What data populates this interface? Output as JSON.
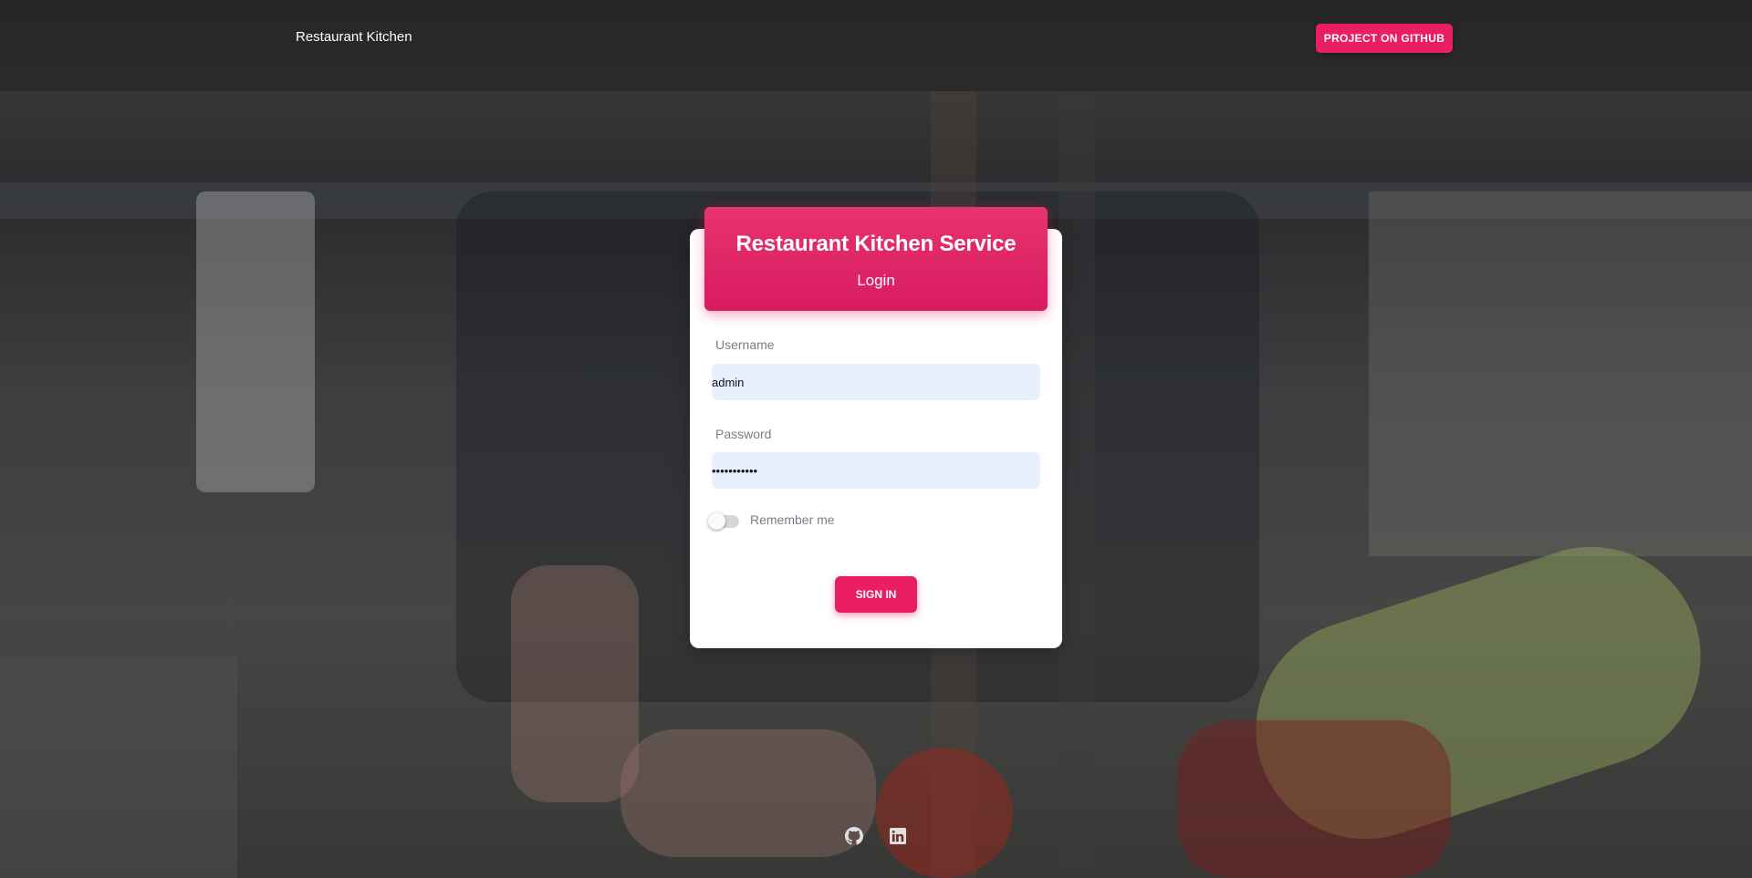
{
  "navbar": {
    "brand": "Restaurant Kitchen",
    "github_button": "PROJECT ON GITHUB"
  },
  "card": {
    "title": "Restaurant Kitchen Service",
    "subtitle": "Login",
    "username_label": "Username",
    "username_value": "admin",
    "password_label": "Password",
    "password_value": "•••••••••••",
    "remember_label": "Remember me",
    "remember_checked": false,
    "signin_button": "SIGN IN"
  },
  "footer": {
    "icons": [
      "github-icon",
      "linkedin-icon"
    ]
  },
  "colors": {
    "accent": "#e91e63",
    "input_bg": "#e8f0fe"
  }
}
